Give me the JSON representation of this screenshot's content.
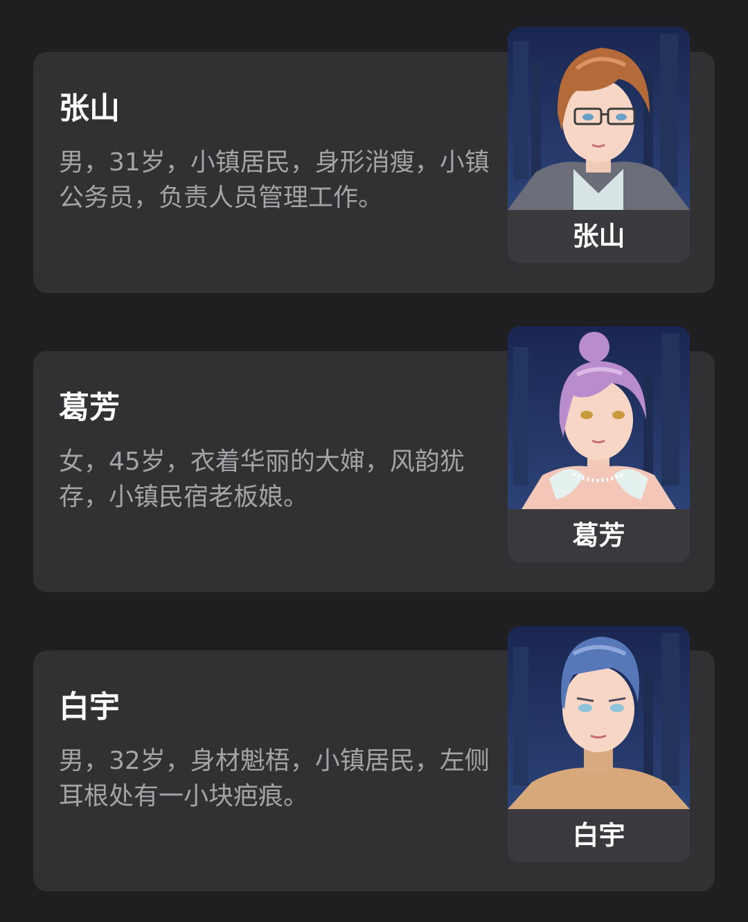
{
  "characters": [
    {
      "name": "张山",
      "description": "男，31岁，小镇居民，身形消瘦，小镇公务员，负责人员管理工作。",
      "portrait_label": "张山",
      "portrait_icon": "glasses-man-portrait-icon"
    },
    {
      "name": "葛芳",
      "description": "女，45岁，衣着华丽的大婶，风韵犹存，小镇民宿老板娘。",
      "portrait_label": "葛芳",
      "portrait_icon": "bun-hair-woman-portrait-icon"
    },
    {
      "name": "白宇",
      "description": "男，32岁，身材魁梧，小镇居民，左侧耳根处有一小块疤痕。",
      "portrait_label": "白宇",
      "portrait_icon": "blue-hair-man-portrait-icon"
    }
  ],
  "colors": {
    "background": "#1f1f21",
    "card": "#313134",
    "label_bg": "#3a3a3e",
    "text_primary": "#ffffff",
    "text_secondary": "#a4a4a7"
  }
}
